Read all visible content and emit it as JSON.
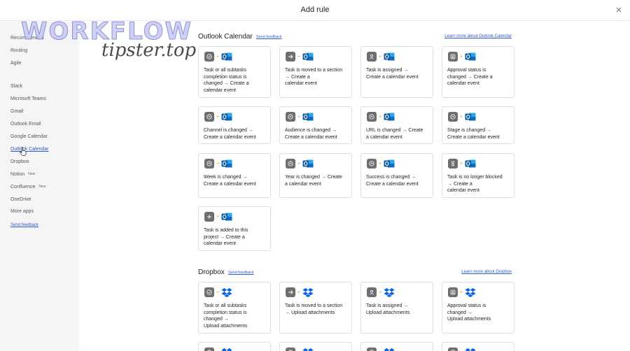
{
  "header": {
    "title": "Add rule"
  },
  "watermark": {
    "line1": "WORKFLOW",
    "line2": "tipster.top"
  },
  "sidebar": {
    "items": [
      {
        "label": "Recommended",
        "tag": ""
      },
      {
        "label": "Routing",
        "tag": ""
      },
      {
        "label": "Agile",
        "tag": ""
      },
      {
        "label": "Slack",
        "tag": ""
      },
      {
        "label": "Microsoft Teams",
        "tag": ""
      },
      {
        "label": "Gmail",
        "tag": ""
      },
      {
        "label": "Outlook Email",
        "tag": ""
      },
      {
        "label": "Google Calendar",
        "tag": ""
      },
      {
        "label": "Outlook Calendar",
        "tag": ""
      },
      {
        "label": "Dropbox",
        "tag": ""
      },
      {
        "label": "Notion",
        "tag": "New"
      },
      {
        "label": "Confluence",
        "tag": "New"
      },
      {
        "label": "OneDrive",
        "tag": ""
      },
      {
        "label": "More apps",
        "tag": ""
      }
    ],
    "feedback": "Send feedback"
  },
  "sections": [
    {
      "title": "Outlook Calendar",
      "feedback": "Send feedback",
      "learn_more": "Learn more about Outlook Calendar",
      "cards": [
        {
          "text": "Task or all subtasks\ncompletion status is\nchanged → Create a\ncalendar event",
          "trigger_icon": "check-circle-icon"
        },
        {
          "text": "Task is moved to a section\n→ Create a\ncalendar event",
          "trigger_icon": "arrow-right-icon"
        },
        {
          "text": "Task is assigned  →\nCreate a calendar event",
          "trigger_icon": "person-icon"
        },
        {
          "text": "Approval status is\nchanged → Create a\ncalendar event",
          "trigger_icon": "approval-icon"
        },
        {
          "text": "Channel is changed →\nCreate a calendar event",
          "trigger_icon": "field-icon"
        },
        {
          "text": "Audience is changed →\nCreate a calendar event",
          "trigger_icon": "field-icon"
        },
        {
          "text": "URL is changed → Create\na calendar event",
          "trigger_icon": "field-icon"
        },
        {
          "text": "Stage is changed →\nCreate a calendar event",
          "trigger_icon": "field-icon"
        },
        {
          "text": "Week is changed →\nCreate a calendar event",
          "trigger_icon": "field-icon"
        },
        {
          "text": "Year is changed → Create\na calendar event",
          "trigger_icon": "field-icon"
        },
        {
          "text": "Success is changed →\nCreate a calendar event",
          "trigger_icon": "field-icon"
        },
        {
          "text": "Task is no longer blocked\n→ Create a\ncalendar event",
          "trigger_icon": "hourglass-icon"
        },
        {
          "text": "Task is added to this\nproject  → Create a\ncalendar event",
          "trigger_icon": "plus-icon"
        }
      ]
    },
    {
      "title": "Dropbox",
      "feedback": "Send feedback",
      "learn_more": "Learn more about Dropbox",
      "cards": [
        {
          "text": "Task or all subtasks\ncompletion status is\nchanged →\nUpload attachments",
          "trigger_icon": "check-circle-icon"
        },
        {
          "text": "Task is moved to a section\n→ Upload attachments",
          "trigger_icon": "arrow-right-icon"
        },
        {
          "text": "Task is assigned  →\nUpload attachments",
          "trigger_icon": "person-icon"
        },
        {
          "text": "Approval status is\nchanged →\nUpload attachments",
          "trigger_icon": "approval-icon"
        },
        {
          "text": "",
          "trigger_icon": "field-icon"
        },
        {
          "text": "",
          "trigger_icon": "field-icon"
        },
        {
          "text": "",
          "trigger_icon": "field-icon"
        },
        {
          "text": "",
          "trigger_icon": "field-icon"
        }
      ]
    }
  ],
  "colors": {
    "accent": "#2a5bd7",
    "outlook": "#0f6cbd",
    "dropbox": "#0061fe",
    "trigger": "#6d6e6f",
    "plus": "#f1bd6c"
  }
}
